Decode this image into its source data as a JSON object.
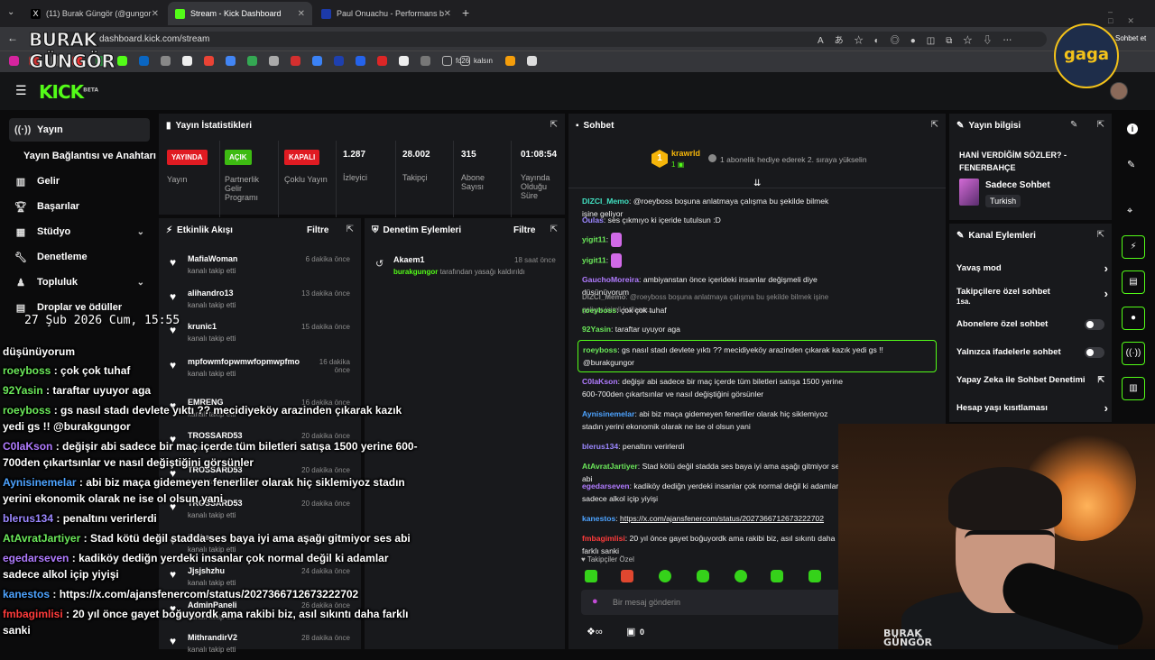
{
  "browser": {
    "tabs": [
      {
        "title": "(11) Burak Güngör (@gungorburak",
        "favcolor": "#000000"
      },
      {
        "title": "Stream - Kick Dashboard",
        "favcolor": "#53fc18"
      },
      {
        "title": "Paul Onuachu - Performans bilgile",
        "favcolor": "#1c3aa9"
      }
    ],
    "url": "dashboard.kick.com/stream",
    "profile_label": "Sohbet et",
    "bookmarks": [
      "fc26",
      "kalsın"
    ]
  },
  "sidebar": {
    "items": [
      {
        "label": "Yayın",
        "icon": "stream-icon"
      },
      {
        "label": "Yayın Bağlantısı ve Anahtarı",
        "icon": ""
      },
      {
        "label": "Gelir",
        "icon": "chart-icon"
      },
      {
        "label": "Başarılar",
        "icon": "trophy-icon"
      },
      {
        "label": "Stüdyo",
        "icon": "studio-icon"
      },
      {
        "label": "Denetleme",
        "icon": "wrench-icon"
      },
      {
        "label": "Topluluk",
        "icon": "community-icon"
      },
      {
        "label": "Droplar ve ödüller",
        "icon": "drops-icon"
      }
    ]
  },
  "stats_panel": {
    "title": "Yayın İstatistikleri",
    "stats": [
      {
        "badge": "YAYINDA",
        "badge_color": "#e01b22",
        "label": "Yayın"
      },
      {
        "badge": "AÇIK",
        "badge_color": "#3dbb12",
        "label": "Partnerlik Gelir Programı"
      },
      {
        "badge": "KAPALI",
        "badge_color": "#e01b22",
        "label": "Çoklu Yayın"
      },
      {
        "value": "1.287",
        "label": "İzleyici"
      },
      {
        "value": "28.002",
        "label": "Takipçi"
      },
      {
        "value": "315",
        "label": "Abone Sayısı"
      },
      {
        "value": "01:08:54",
        "label": "Yayında Olduğu Süre"
      }
    ]
  },
  "activity_panel": {
    "title": "Etkinlik Akışı",
    "filter": "Filtre",
    "events": [
      {
        "name": "MafiaWoman",
        "sub": "kanalı takip etti",
        "time": "6 dakika önce"
      },
      {
        "name": "alihandro13",
        "sub": "kanalı takip etti",
        "time": "13 dakika önce"
      },
      {
        "name": "krunic1",
        "sub": "kanalı takip etti",
        "time": "15 dakika önce"
      },
      {
        "name": "mpfowmfopwmwfopmwpfmo",
        "sub": "kanalı takip etti",
        "time": "16 dakika önce"
      },
      {
        "name": "EMRENG",
        "sub": "kanalı takip etti",
        "time": "16 dakika önce"
      },
      {
        "name": "TROSSARD53",
        "sub": "kanalı takip etti",
        "time": "20 dakika önce"
      },
      {
        "name": "TROSSARD53",
        "sub": "kanalı takip etti",
        "time": "20 dakika önce"
      },
      {
        "name": "TROSSARD53",
        "sub": "kanalı takip etti",
        "time": "20 dakika önce"
      },
      {
        "name": "Zarbar",
        "sub": "kanalı takip etti",
        "time": "20 dakika önce"
      },
      {
        "name": "Jjsjshzhu",
        "sub": "kanalı takip etti",
        "time": "24 dakika önce"
      },
      {
        "name": "AdminPaneli",
        "sub": "kanalı takip etti",
        "time": "26 dakika önce"
      },
      {
        "name": "MithrandirV2",
        "sub": "kanalı takip etti",
        "time": "28 dakika önce"
      }
    ]
  },
  "moderation_panel": {
    "title": "Denetim Eylemleri",
    "filter": "Filtre",
    "actions": [
      {
        "name": "Akaem1",
        "time": "18 saat önce",
        "actor": "burakgungor",
        "text": "tarafından yasağı kaldırıldı"
      }
    ]
  },
  "chat_panel": {
    "title": "Sohbet",
    "pinned_user": "krawrld",
    "pinned_count": "1",
    "pinned_sub": "1",
    "gift_text": "1 abonelik hediye ederek 2. sıraya yükselin",
    "messages": [
      {
        "user": "DIZCI_Memo",
        "color": "#41e0c0",
        "text": "@roeyboss boşuna anlatmaya çalışma bu şekilde bilmek işine geliyor"
      },
      {
        "user": "Oulas",
        "color": "#9b87ff",
        "text": "ses çıkmıyo ki içeride tutulsun :D"
      },
      {
        "user": "yigit11",
        "color": "#6be85a",
        "text": ""
      },
      {
        "user": "yigit11",
        "color": "#6be85a",
        "text": ""
      },
      {
        "user": "GauchoMoreira",
        "color": "#b07bff",
        "text": "ambiyanstan önce içerideki insanlar değişmeli diye düşünüyorum"
      },
      {
        "user": "DIZCI_Memo",
        "color": "#8a8a8a",
        "text": "@roeyboss boşuna anlatmaya çalışma bu şekilde bilmek işine geliyor isimli kullanıc..."
      },
      {
        "user": "roeyboss",
        "color": "#6be85a",
        "text": "çok çok tuhaf"
      },
      {
        "user": "92Yasin",
        "color": "#6be85a",
        "text": "taraftar uyuyor aga"
      },
      {
        "user": "roeyboss",
        "color": "#6be85a",
        "text": "gs nasıl stadı devlete yıktı ?? mecidiyeköy arazinden çıkarak kazık yedi gs !! @burakgungor"
      },
      {
        "user": "C0laKson",
        "color": "#b07bff",
        "text": "değişir abi sadece bir maç içerde tüm biletleri satışa 1500 yerine 600-700den çıkartsınlar ve nasıl değiştiğini görsünler"
      },
      {
        "user": "Aynisinemelar",
        "color": "#4da3ff",
        "text": "abi biz maça gidemeyen fenerliler olarak hiç siklemiyoz stadın yerini ekonomik olarak ne ise ol olsun yani"
      },
      {
        "user": "blerus134",
        "color": "#9b87ff",
        "text": "penaltını verirlerdi"
      },
      {
        "user": "AtAvratJartiyer",
        "color": "#6be85a",
        "text": "Stad kötü değil stadda ses baya iyi ama aşağı gitmiyor ses abi"
      },
      {
        "user": "egedarseven",
        "color": "#b07bff",
        "text": "kadiköy dediğn yerdeki insanlar çok normal değil ki adamlar sadece alkol içip yiyişi"
      },
      {
        "user": "kanestos",
        "color": "#4da3ff",
        "text": "https://x.com/ajansfenercom/status/2027366712673222702"
      },
      {
        "user": "fmbagimlisi",
        "color": "#ff3b3b",
        "text": "20 yıl önce gayet boğuyordk ama rakibi biz, asıl sıkıntı daha farklı sanki"
      }
    ],
    "followers_only": "Takipçiler Özel",
    "input_placeholder": "Bir mesaj gönderin",
    "footer_count": "0"
  },
  "info_panel": {
    "title": "Yayın bilgisi",
    "stream_title": "HANİ VERDİĞİM SÖZLER? - FENERBAHÇE",
    "category": "Sadece Sohbet",
    "language": "Turkish"
  },
  "channel_actions": {
    "title": "Kanal Eylemleri",
    "rows": [
      {
        "label": "Yavaş mod",
        "kind": "chevron",
        "sub": ""
      },
      {
        "label": "Takipçilere özel sohbet",
        "kind": "chevron",
        "sub": "1sa."
      },
      {
        "label": "Abonelere özel sohbet",
        "kind": "toggle",
        "sub": ""
      },
      {
        "label": "Yalnızca ifadelerle sohbet",
        "kind": "toggle",
        "sub": ""
      },
      {
        "label": "Yapay Zeka ile Sohbet Denetimi",
        "kind": "link",
        "sub": ""
      },
      {
        "label": "Hesap yaşı kısıtlaması",
        "kind": "chevron",
        "sub": ""
      }
    ]
  },
  "overlay": {
    "clock": "27 Şub 2026 Cum, 15:55",
    "lines": [
      {
        "user": "",
        "color": "#ffffff",
        "text": "düşünüyorum"
      },
      {
        "user": "roeyboss",
        "color": "#6be85a",
        "text": "çok çok tuhaf"
      },
      {
        "user": "92Yasin",
        "color": "#6be85a",
        "text": "taraftar uyuyor aga"
      },
      {
        "user": "roeyboss",
        "color": "#6be85a",
        "text": "gs nasıl stadı devlete yıktı ?? mecidiyeköy arazinden çıkarak kazık yedi gs !! @burakgungor"
      },
      {
        "user": "C0laKson",
        "color": "#b07bff",
        "text": "değişir abi sadece bir maç içerde tüm biletleri satışa 1500 yerine 600-700den çıkartsınlar ve nasıl değiştiğini görsünler"
      },
      {
        "user": "Aynisinemelar",
        "color": "#4da3ff",
        "text": "abi biz maça gidemeyen fenerliler olarak hiç siklemiyoz stadın yerini ekonomik olarak ne ise ol olsun yani"
      },
      {
        "user": "blerus134",
        "color": "#9b87ff",
        "text": "penaltını verirlerdi"
      },
      {
        "user": "AtAvratJartiyer",
        "color": "#6be85a",
        "text": "Stad kötü değil stadda ses baya iyi ama aşağı gitmiyor ses abi"
      },
      {
        "user": "egedarseven",
        "color": "#b07bff",
        "text": "kadiköy dediğn yerdeki insanlar çok normal değil ki adamlar sadece alkol içip yiyişi"
      },
      {
        "user": "kanestos",
        "color": "#4da3ff",
        "text": "https://x.com/ajansfenercom/status/2027366712673222702"
      },
      {
        "user": "fmbagimlisi",
        "color": "#ff3b3b",
        "text": "20 yıl önce gayet boğuyordk ama rakibi biz, asıl sıkıntı daha farklı sanki"
      }
    ]
  },
  "branding": {
    "watermark": "BURAK GÜNGÖR",
    "gaga_logo": "gaga",
    "kick_logo": "KICK",
    "kick_logo_sup": "BETA"
  },
  "colors": {
    "kick_green": "#53fc18",
    "panel_bg": "#18191c",
    "page_bg": "#0b0b0c"
  }
}
